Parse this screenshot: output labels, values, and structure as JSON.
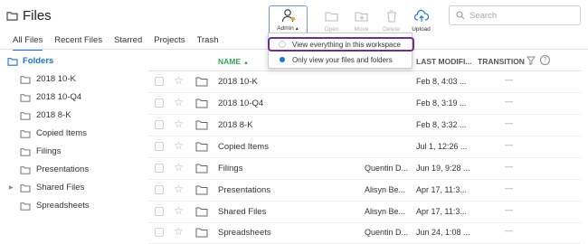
{
  "header": {
    "title": "Files"
  },
  "toolbar": {
    "admin": {
      "label": "Admin",
      "caret": "▲"
    },
    "open": {
      "label": "Open"
    },
    "move": {
      "label": "Move"
    },
    "delete": {
      "label": "Delete"
    },
    "upload": {
      "label": "Upload"
    }
  },
  "search": {
    "placeholder": "Search",
    "value": ""
  },
  "tabs": [
    {
      "label": "All Files",
      "active": true
    },
    {
      "label": "Recent Files"
    },
    {
      "label": "Starred"
    },
    {
      "label": "Projects"
    },
    {
      "label": "Trash"
    }
  ],
  "sidebar": {
    "heading": "Folders",
    "items": [
      {
        "label": "2018 10-K"
      },
      {
        "label": "2018 10-Q4"
      },
      {
        "label": "2018 8-K"
      },
      {
        "label": "Copied Items"
      },
      {
        "label": "Filings"
      },
      {
        "label": "Presentations"
      },
      {
        "label": "Shared Files",
        "expandable": true
      },
      {
        "label": "Spreadsheets"
      }
    ]
  },
  "table": {
    "columns": {
      "name": "NAME",
      "modified": "LAST MODIFI...",
      "transition": "TRANSITION"
    },
    "rows": [
      {
        "name": "2018 10-K",
        "owner": "",
        "modified": "Feb 8, 4:03 ...",
        "transition": "—"
      },
      {
        "name": "2018 10-Q4",
        "owner": "",
        "modified": "Feb 8, 3:19 ...",
        "transition": "—"
      },
      {
        "name": "2018 8-K",
        "owner": "",
        "modified": "Feb 8, 3:32 ...",
        "transition": "—"
      },
      {
        "name": "Copied Items",
        "owner": "",
        "modified": "Jul 1, 12:26 ...",
        "transition": "—"
      },
      {
        "name": "Filings",
        "owner": "Quentin D...",
        "modified": "Jun 19, 9:28 ...",
        "transition": "—"
      },
      {
        "name": "Presentations",
        "owner": "Alisyn Be...",
        "modified": "Apr 17, 11:3...",
        "transition": "—"
      },
      {
        "name": "Shared Files",
        "owner": "Alisyn Be...",
        "modified": "Apr 17, 11:3...",
        "transition": "—"
      },
      {
        "name": "Spreadsheets",
        "owner": "Quentin D...",
        "modified": "Jun 24, 1:08 ...",
        "transition": "—"
      }
    ]
  },
  "dropdown": {
    "options": [
      {
        "label": "View everything in this workspace",
        "selected": false,
        "highlighted": true
      },
      {
        "label": "Only view your files and folders",
        "selected": true
      }
    ]
  },
  "colors": {
    "accent": "#1a73d8",
    "name_header": "#2daa4f",
    "highlight_outline": "#6b2f97",
    "admin_border": "#6c9bd2"
  },
  "icons": [
    "folder-icon",
    "admin-user-icon",
    "open-folder-icon",
    "move-icon",
    "delete-icon",
    "upload-icon",
    "search-icon",
    "star-icon",
    "filter-icon",
    "help-icon"
  ]
}
